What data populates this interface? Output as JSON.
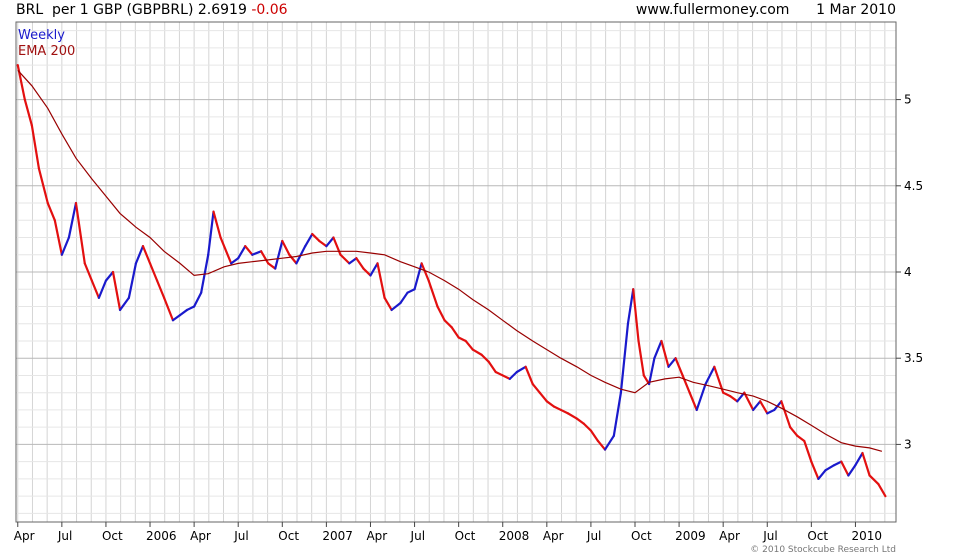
{
  "header": {
    "symbol": "BRL",
    "description": "per 1 GBP (GBPBRL)",
    "last": "2.6919",
    "change": "-0.06",
    "site": "www.fullermoney.com",
    "date": "1 Mar 2010"
  },
  "legend": {
    "interval": "Weekly",
    "ema": "EMA 200"
  },
  "copyright": "© 2010 Stockcube Research Ltd",
  "colors": {
    "up": "#1a1acc",
    "down": "#e31010",
    "ema": "#990000",
    "grid": "#d4d4d4"
  },
  "chart_data": {
    "type": "line",
    "title": "BRL per 1 GBP (GBPBRL)",
    "ylim": [
      2.55,
      5.45
    ],
    "xlim": [
      2005.24,
      2010.23
    ],
    "y_ticks": [
      3,
      3.5,
      4,
      4.5,
      5
    ],
    "y_tick_labels": [
      "3",
      "3.5",
      "4",
      "4.5",
      "5"
    ],
    "x_ticks": [
      {
        "label": "Apr",
        "t": 2005.25
      },
      {
        "label": "Jul",
        "t": 2005.5
      },
      {
        "label": "Oct",
        "t": 2005.75
      },
      {
        "label": "2006",
        "t": 2006.0
      },
      {
        "label": "Apr",
        "t": 2006.25
      },
      {
        "label": "Jul",
        "t": 2006.5
      },
      {
        "label": "Oct",
        "t": 2006.75
      },
      {
        "label": "2007",
        "t": 2007.0
      },
      {
        "label": "Apr",
        "t": 2007.25
      },
      {
        "label": "Jul",
        "t": 2007.5
      },
      {
        "label": "Oct",
        "t": 2007.75
      },
      {
        "label": "2008",
        "t": 2008.0
      },
      {
        "label": "Apr",
        "t": 2008.25
      },
      {
        "label": "Jul",
        "t": 2008.5
      },
      {
        "label": "Oct",
        "t": 2008.75
      },
      {
        "label": "2009",
        "t": 2009.0
      },
      {
        "label": "Apr",
        "t": 2009.25
      },
      {
        "label": "Jul",
        "t": 2009.5
      },
      {
        "label": "Oct",
        "t": 2009.75
      },
      {
        "label": "2010",
        "t": 2010.0
      }
    ],
    "grid": true,
    "y_axis_position": "right",
    "series": [
      {
        "name": "Weekly",
        "x": [
          2005.25,
          2005.29,
          2005.33,
          2005.37,
          2005.42,
          2005.46,
          2005.5,
          2005.54,
          2005.58,
          2005.63,
          2005.67,
          2005.71,
          2005.75,
          2005.79,
          2005.83,
          2005.88,
          2005.92,
          2005.96,
          2006.0,
          2006.04,
          2006.08,
          2006.13,
          2006.17,
          2006.21,
          2006.25,
          2006.29,
          2006.33,
          2006.36,
          2006.4,
          2006.46,
          2006.5,
          2006.54,
          2006.58,
          2006.63,
          2006.67,
          2006.71,
          2006.75,
          2006.79,
          2006.83,
          2006.88,
          2006.92,
          2006.96,
          2007.0,
          2007.04,
          2007.08,
          2007.13,
          2007.17,
          2007.21,
          2007.25,
          2007.29,
          2007.33,
          2007.37,
          2007.42,
          2007.46,
          2007.5,
          2007.54,
          2007.58,
          2007.63,
          2007.67,
          2007.71,
          2007.75,
          2007.79,
          2007.83,
          2007.88,
          2007.92,
          2007.96,
          2008.0,
          2008.04,
          2008.08,
          2008.13,
          2008.17,
          2008.21,
          2008.25,
          2008.29,
          2008.33,
          2008.37,
          2008.42,
          2008.46,
          2008.5,
          2008.54,
          2008.58,
          2008.63,
          2008.67,
          2008.71,
          2008.74,
          2008.77,
          2008.8,
          2008.83,
          2008.86,
          2008.9,
          2008.94,
          2008.98,
          2009.02,
          2009.06,
          2009.1,
          2009.15,
          2009.2,
          2009.25,
          2009.29,
          2009.33,
          2009.37,
          2009.42,
          2009.46,
          2009.5,
          2009.54,
          2009.58,
          2009.63,
          2009.67,
          2009.71,
          2009.75,
          2009.79,
          2009.83,
          2009.88,
          2009.92,
          2009.96,
          2010.0,
          2010.04,
          2010.08,
          2010.13,
          2010.17
        ],
        "y": [
          5.2,
          5.0,
          4.85,
          4.6,
          4.4,
          4.3,
          4.1,
          4.2,
          4.4,
          4.05,
          3.95,
          3.85,
          3.95,
          4.0,
          3.78,
          3.85,
          4.05,
          4.15,
          4.05,
          3.95,
          3.85,
          3.72,
          3.75,
          3.78,
          3.8,
          3.88,
          4.1,
          4.35,
          4.2,
          4.05,
          4.08,
          4.15,
          4.1,
          4.12,
          4.05,
          4.02,
          4.18,
          4.1,
          4.05,
          4.15,
          4.22,
          4.18,
          4.15,
          4.2,
          4.1,
          4.05,
          4.08,
          4.02,
          3.98,
          4.05,
          3.85,
          3.78,
          3.82,
          3.88,
          3.9,
          4.05,
          3.95,
          3.8,
          3.72,
          3.68,
          3.62,
          3.6,
          3.55,
          3.52,
          3.48,
          3.42,
          3.4,
          3.38,
          3.42,
          3.45,
          3.35,
          3.3,
          3.25,
          3.22,
          3.2,
          3.18,
          3.15,
          3.12,
          3.08,
          3.02,
          2.97,
          3.05,
          3.3,
          3.7,
          3.9,
          3.6,
          3.4,
          3.35,
          3.5,
          3.6,
          3.45,
          3.5,
          3.4,
          3.3,
          3.2,
          3.35,
          3.45,
          3.3,
          3.28,
          3.25,
          3.3,
          3.2,
          3.25,
          3.18,
          3.2,
          3.25,
          3.1,
          3.05,
          3.02,
          2.9,
          2.8,
          2.85,
          2.88,
          2.9,
          2.82,
          2.88,
          2.95,
          2.82,
          2.77,
          2.7
        ]
      },
      {
        "name": "EMA 200",
        "x": [
          2005.25,
          2005.33,
          2005.42,
          2005.5,
          2005.58,
          2005.67,
          2005.75,
          2005.83,
          2005.92,
          2006.0,
          2006.08,
          2006.17,
          2006.25,
          2006.33,
          2006.42,
          2006.5,
          2006.58,
          2006.67,
          2006.75,
          2006.83,
          2006.92,
          2007.0,
          2007.08,
          2007.17,
          2007.25,
          2007.33,
          2007.42,
          2007.5,
          2007.58,
          2007.67,
          2007.75,
          2007.83,
          2007.92,
          2008.0,
          2008.08,
          2008.17,
          2008.25,
          2008.33,
          2008.42,
          2008.5,
          2008.58,
          2008.67,
          2008.75,
          2008.83,
          2008.92,
          2009.0,
          2009.08,
          2009.17,
          2009.25,
          2009.33,
          2009.42,
          2009.5,
          2009.58,
          2009.67,
          2009.75,
          2009.83,
          2009.92,
          2010.0,
          2010.08,
          2010.15
        ],
        "y": [
          5.17,
          5.08,
          4.95,
          4.8,
          4.66,
          4.54,
          4.44,
          4.34,
          4.26,
          4.2,
          4.12,
          4.05,
          3.98,
          3.99,
          4.03,
          4.05,
          4.06,
          4.07,
          4.08,
          4.09,
          4.11,
          4.12,
          4.12,
          4.12,
          4.11,
          4.1,
          4.06,
          4.03,
          4.0,
          3.95,
          3.9,
          3.84,
          3.78,
          3.72,
          3.66,
          3.6,
          3.55,
          3.5,
          3.45,
          3.4,
          3.36,
          3.32,
          3.3,
          3.36,
          3.38,
          3.39,
          3.36,
          3.34,
          3.32,
          3.3,
          3.28,
          3.25,
          3.21,
          3.16,
          3.11,
          3.06,
          3.01,
          2.99,
          2.98,
          2.96
        ]
      }
    ]
  }
}
